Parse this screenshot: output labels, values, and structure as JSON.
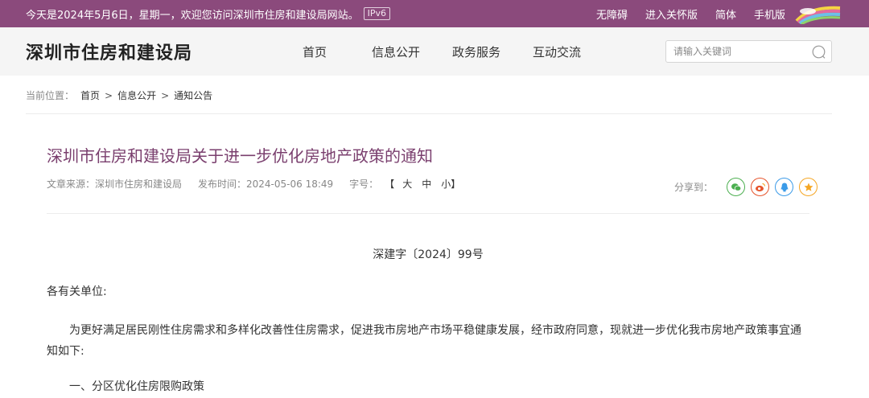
{
  "topbar": {
    "welcome": "今天是2024年5月6日，星期一，欢迎您访问深圳市住房和建设局网站。",
    "ipv6": "IPv6",
    "links": [
      "无障碍",
      "进入关怀版",
      "简体",
      "手机版"
    ],
    "bg_color": "#8b4a7c"
  },
  "header": {
    "site_title": "深圳市住房和建设局",
    "nav": [
      "首页",
      "信息公开",
      "政务服务",
      "互动交流"
    ],
    "search_placeholder": "请输入关键词"
  },
  "breadcrumb": {
    "label": "当前位置：",
    "items": [
      "首页",
      "信息公开",
      "通知公告"
    ],
    "separator": ">"
  },
  "article": {
    "title": "深圳市住房和建设局关于进一步优化房地产政策的通知",
    "title_color": "#7a3f6e",
    "source": "文章来源：深圳市住房和建设局",
    "published": "发布时间：2024-05-06 18:49",
    "fontsize_label": "字号：",
    "fontsize_options": [
      "【",
      "大",
      "中",
      "小】"
    ],
    "share_label": "分享到：",
    "share_icons": [
      "wechat-icon",
      "weibo-icon",
      "qq-icon",
      "favorite-icon"
    ],
    "doc_no": "深建字〔2024〕99号",
    "addressee": "各有关单位:",
    "body": "为更好满足居民刚性住房需求和多样化改善性住房需求，促进我市房地产市场平稳健康发展，经市政府同意，现就进一步优化我市房地产政策事宜通知如下:",
    "section_1": "一、分区优化住房限购政策"
  }
}
